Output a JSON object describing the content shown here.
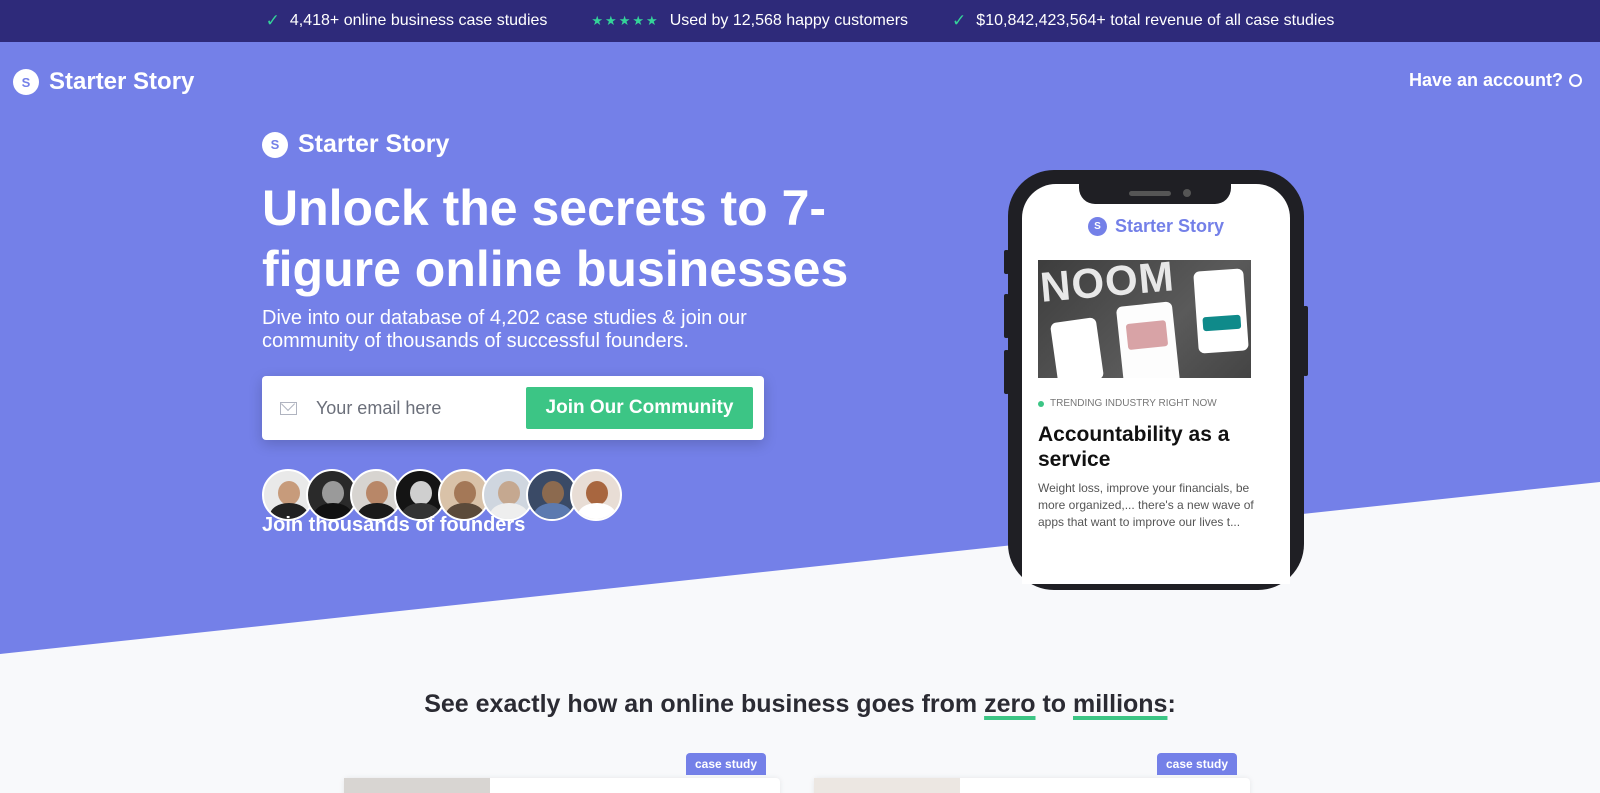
{
  "topbar": {
    "stats": [
      {
        "text": "4,418+ online business case studies",
        "icon": "check-icon"
      },
      {
        "text": "Used by 12,568 happy customers",
        "icon": "five-stars-icon"
      },
      {
        "text": "$10,842,423,564+ total revenue of all case studies",
        "icon": "check-icon"
      }
    ],
    "stars": "★★★★★"
  },
  "nav": {
    "logo_letter": "S",
    "logo_text": "Starter Story",
    "account_label": "Have an account?"
  },
  "hero": {
    "brand_letter": "S",
    "brand_text": "Starter Story",
    "headline": "Unlock the secrets to 7-figure online businesses",
    "subheadline": "Dive into our database of 4,202 case studies & join our community of thousands of successful founders.",
    "email_placeholder": "Your email here",
    "cta_label": "Join Our Community",
    "join_text": "Join thousands of founders"
  },
  "phone": {
    "logo_letter": "S",
    "logo_text": "Starter Story",
    "image_text": "NOOM",
    "trending_label": "TRENDING INDUSTRY RIGHT NOW",
    "article_title": "Accountability as a service",
    "article_body": "Weight loss, improve your financials, be more organized,... there's a new wave of apps that want to improve our lives t..."
  },
  "section": {
    "title_pre": "See exactly how an online business goes from ",
    "title_hl1": "zero",
    "title_mid": " to ",
    "title_hl2": "millions",
    "title_post": ":",
    "badges": [
      "case study",
      "case study"
    ]
  },
  "colors": {
    "topbar": "#2e2a7a",
    "hero": "#7480e8",
    "accent_green": "#3cc585",
    "section_bg": "#f8f9fb"
  }
}
